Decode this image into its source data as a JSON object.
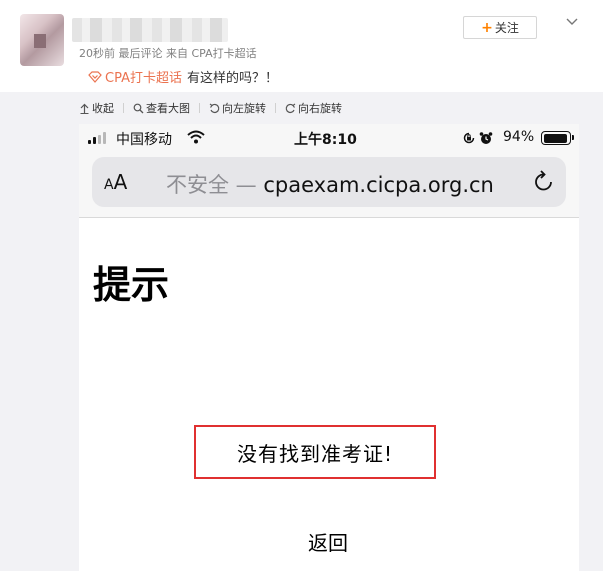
{
  "post": {
    "meta": "20秒前 最后评论 来自 CPA打卡超话",
    "follow_label": "关注",
    "follow_plus": "+",
    "topic": "CPA打卡超话",
    "text": "有这样的吗？！"
  },
  "toolbar": {
    "collapse": "收起",
    "view_large": "查看大图",
    "rotate_left": "向左旋转",
    "rotate_right": "向右旋转"
  },
  "phone": {
    "carrier": "中国移动",
    "time": "上午8:10",
    "battery": "94%",
    "battery_level": 0.94,
    "aa_small": "A",
    "aa_large": "A",
    "url_insecure": "不安全 — ",
    "url_host": "cpaexam.cicpa.org.cn"
  },
  "page": {
    "title": "提示",
    "message": "没有找到准考证!",
    "back": "返回"
  },
  "colors": {
    "accent_orange": "#ff8200",
    "topic_color": "#eb7350",
    "highlight_red": "#e03030"
  }
}
